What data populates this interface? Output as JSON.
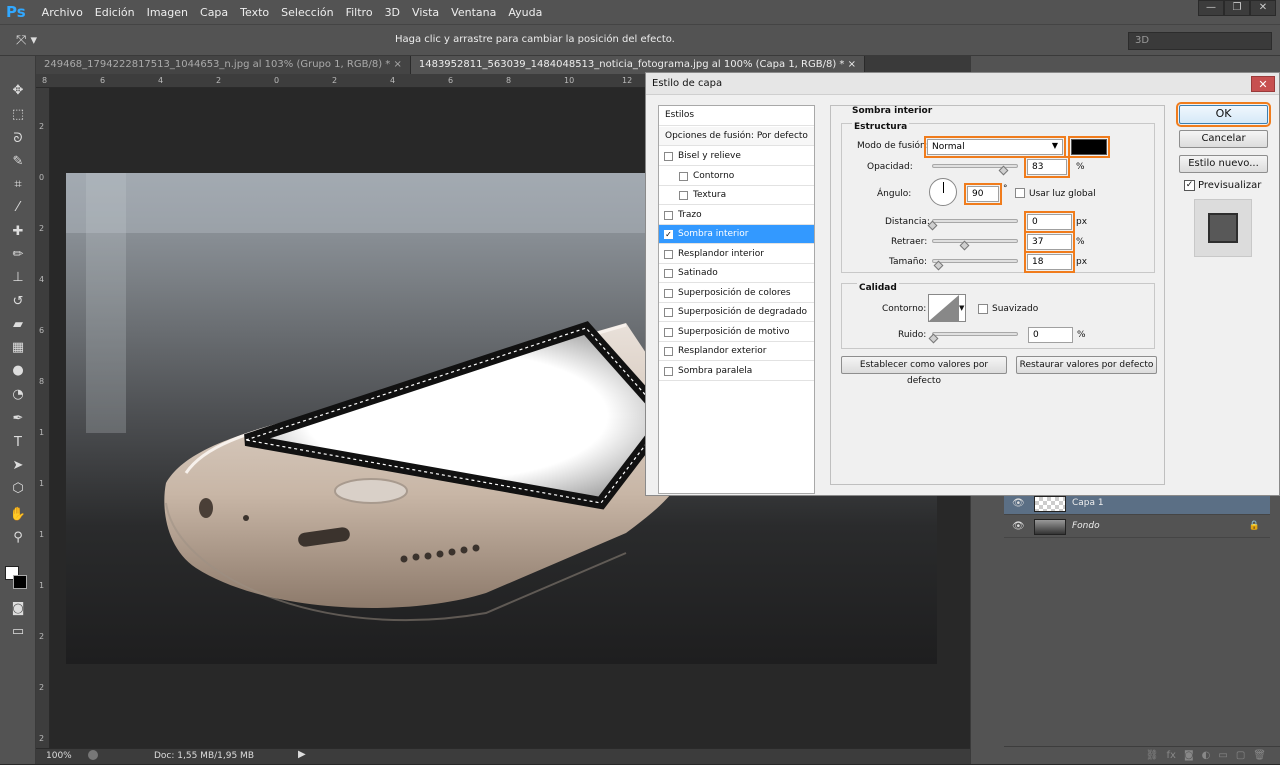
{
  "app": {
    "logo": "Ps"
  },
  "menu": [
    "Archivo",
    "Edición",
    "Imagen",
    "Capa",
    "Texto",
    "Selección",
    "Filtro",
    "3D",
    "Vista",
    "Ventana",
    "Ayuda"
  ],
  "window_controls": [
    "—",
    "❐",
    "✕"
  ],
  "options_bar": {
    "hint": "Haga clic y arrastre para cambiar la posición del efecto.",
    "workspace": "3D"
  },
  "tabs": [
    {
      "label": "249468_1794222817513_1044653_n.jpg al 103% (Grupo 1, RGB/8) *",
      "close": "×"
    },
    {
      "label": "1483952811_563039_1484048513_noticia_fotograma.jpg al 100% (Capa 1, RGB/8) *",
      "close": "×"
    }
  ],
  "ruler_top": [
    "8",
    "6",
    "4",
    "2",
    "0",
    "2",
    "4",
    "6",
    "8",
    "10",
    "12",
    "14",
    "16",
    "18",
    "20",
    "22",
    "24"
  ],
  "ruler_left": [
    "2",
    "0",
    "2",
    "4",
    "6",
    "8",
    "1",
    "1",
    "1",
    "1",
    "2",
    "2",
    "2"
  ],
  "status": {
    "zoom": "100%",
    "doc": "Doc: 1,55 MB/1,95 MB"
  },
  "layers": [
    {
      "name": "Capa 1",
      "selected": true,
      "locked": false
    },
    {
      "name": "Fondo",
      "selected": false,
      "locked": true
    }
  ],
  "dialog": {
    "title": "Estilo de capa",
    "close": "✕",
    "styles_header": "Estilos",
    "blend_options": "Opciones de fusión: Por defecto",
    "style_items": [
      {
        "label": "Bisel y relieve",
        "checked": false,
        "indent": 0
      },
      {
        "label": "Contorno",
        "checked": false,
        "indent": 1
      },
      {
        "label": "Textura",
        "checked": false,
        "indent": 1
      },
      {
        "label": "Trazo",
        "checked": false,
        "indent": 0
      },
      {
        "label": "Sombra interior",
        "checked": true,
        "indent": 0
      },
      {
        "label": "Resplandor interior",
        "checked": false,
        "indent": 0
      },
      {
        "label": "Satinado",
        "checked": false,
        "indent": 0
      },
      {
        "label": "Superposición de colores",
        "checked": false,
        "indent": 0
      },
      {
        "label": "Superposición de degradado",
        "checked": false,
        "indent": 0
      },
      {
        "label": "Superposición de motivo",
        "checked": false,
        "indent": 0
      },
      {
        "label": "Resplandor exterior",
        "checked": false,
        "indent": 0
      },
      {
        "label": "Sombra paralela",
        "checked": false,
        "indent": 0
      }
    ],
    "section_title": "Sombra interior",
    "structure": {
      "title": "Estructura",
      "blend_mode_label": "Modo de fusión:",
      "blend_mode_value": "Normal",
      "color": "#000000",
      "opacity_label": "Opacidad:",
      "opacity_value": "83",
      "opacity_unit": "%",
      "opacity_level": 0.83,
      "angle_label": "Ángulo:",
      "angle_value": "90",
      "angle_unit": "°",
      "global_light_label": "Usar luz global",
      "distance_label": "Distancia:",
      "distance_value": "0",
      "distance_unit": "px",
      "distance_level": 0.0,
      "choke_label": "Retraer:",
      "choke_value": "37",
      "choke_unit": "%",
      "choke_level": 0.37,
      "size_label": "Tamaño:",
      "size_value": "18",
      "size_unit": "px",
      "size_level": 0.07
    },
    "quality": {
      "title": "Calidad",
      "contour_label": "Contorno:",
      "antialias_label": "Suavizado",
      "noise_label": "Ruido:",
      "noise_value": "0",
      "noise_unit": "%"
    },
    "buttons": {
      "set_default": "Establecer como valores por defecto",
      "reset_default": "Restaurar valores por defecto",
      "ok": "OK",
      "cancel": "Cancelar",
      "new_style": "Estilo nuevo...",
      "preview": "Previsualizar"
    }
  }
}
